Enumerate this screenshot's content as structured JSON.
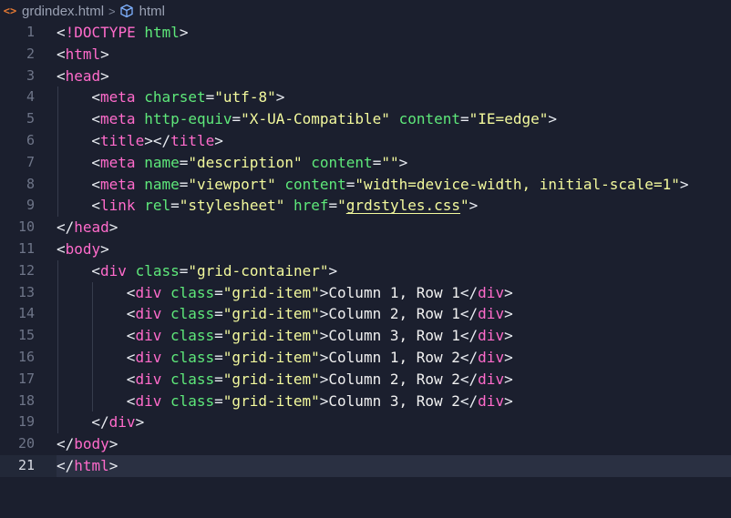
{
  "breadcrumb": {
    "file_icon": "<>",
    "file_name": "grdindex.html",
    "separator": ">",
    "symbol_icon": "cube-icon",
    "element": "html"
  },
  "editor": {
    "current_line": 21,
    "lines": [
      {
        "n": "1",
        "indent": 0,
        "tokens": [
          [
            "punct",
            "<"
          ],
          [
            "tag",
            "!DOCTYPE"
          ],
          [
            "punct",
            " "
          ],
          [
            "attr",
            "html"
          ],
          [
            "punct",
            ">"
          ]
        ]
      },
      {
        "n": "2",
        "indent": 0,
        "tokens": [
          [
            "punct",
            "<"
          ],
          [
            "tag",
            "html"
          ],
          [
            "punct",
            ">"
          ]
        ]
      },
      {
        "n": "3",
        "indent": 0,
        "tokens": [
          [
            "punct",
            "<"
          ],
          [
            "tag",
            "head"
          ],
          [
            "punct",
            ">"
          ]
        ]
      },
      {
        "n": "4",
        "indent": 1,
        "tokens": [
          [
            "punct",
            "<"
          ],
          [
            "tag",
            "meta"
          ],
          [
            "punct",
            " "
          ],
          [
            "attr",
            "charset"
          ],
          [
            "punct",
            "="
          ],
          [
            "str",
            "\"utf-8\""
          ],
          [
            "punct",
            ">"
          ]
        ]
      },
      {
        "n": "5",
        "indent": 1,
        "tokens": [
          [
            "punct",
            "<"
          ],
          [
            "tag",
            "meta"
          ],
          [
            "punct",
            " "
          ],
          [
            "attr",
            "http-equiv"
          ],
          [
            "punct",
            "="
          ],
          [
            "str",
            "\"X-UA-Compatible\""
          ],
          [
            "punct",
            " "
          ],
          [
            "attr",
            "content"
          ],
          [
            "punct",
            "="
          ],
          [
            "str",
            "\"IE=edge\""
          ],
          [
            "punct",
            ">"
          ]
        ]
      },
      {
        "n": "6",
        "indent": 1,
        "tokens": [
          [
            "punct",
            "<"
          ],
          [
            "tag",
            "title"
          ],
          [
            "punct",
            "></"
          ],
          [
            "tag",
            "title"
          ],
          [
            "punct",
            ">"
          ]
        ]
      },
      {
        "n": "7",
        "indent": 1,
        "tokens": [
          [
            "punct",
            "<"
          ],
          [
            "tag",
            "meta"
          ],
          [
            "punct",
            " "
          ],
          [
            "attr",
            "name"
          ],
          [
            "punct",
            "="
          ],
          [
            "str",
            "\"description\""
          ],
          [
            "punct",
            " "
          ],
          [
            "attr",
            "content"
          ],
          [
            "punct",
            "="
          ],
          [
            "str",
            "\"\""
          ],
          [
            "punct",
            ">"
          ]
        ]
      },
      {
        "n": "8",
        "indent": 1,
        "tokens": [
          [
            "punct",
            "<"
          ],
          [
            "tag",
            "meta"
          ],
          [
            "punct",
            " "
          ],
          [
            "attr",
            "name"
          ],
          [
            "punct",
            "="
          ],
          [
            "str",
            "\"viewport\""
          ],
          [
            "punct",
            " "
          ],
          [
            "attr",
            "content"
          ],
          [
            "punct",
            "="
          ],
          [
            "str",
            "\"width=device-width, initial-scale=1\""
          ],
          [
            "punct",
            ">"
          ]
        ]
      },
      {
        "n": "9",
        "indent": 1,
        "tokens": [
          [
            "punct",
            "<"
          ],
          [
            "tag",
            "link"
          ],
          [
            "punct",
            " "
          ],
          [
            "attr",
            "rel"
          ],
          [
            "punct",
            "="
          ],
          [
            "str",
            "\"stylesheet\""
          ],
          [
            "punct",
            " "
          ],
          [
            "attr",
            "href"
          ],
          [
            "punct",
            "="
          ],
          [
            "str",
            "\""
          ],
          [
            "link",
            "grdstyles.css"
          ],
          [
            "str",
            "\""
          ],
          [
            "punct",
            ">"
          ]
        ]
      },
      {
        "n": "10",
        "indent": 0,
        "tokens": [
          [
            "punct",
            "</"
          ],
          [
            "tag",
            "head"
          ],
          [
            "punct",
            ">"
          ]
        ]
      },
      {
        "n": "11",
        "indent": 0,
        "tokens": [
          [
            "punct",
            "<"
          ],
          [
            "tag",
            "body"
          ],
          [
            "punct",
            ">"
          ]
        ]
      },
      {
        "n": "12",
        "indent": 1,
        "tokens": [
          [
            "punct",
            "<"
          ],
          [
            "tag",
            "div"
          ],
          [
            "punct",
            " "
          ],
          [
            "attr",
            "class"
          ],
          [
            "punct",
            "="
          ],
          [
            "str",
            "\"grid-container\""
          ],
          [
            "punct",
            ">"
          ]
        ]
      },
      {
        "n": "13",
        "indent": 2,
        "tokens": [
          [
            "punct",
            "<"
          ],
          [
            "tag",
            "div"
          ],
          [
            "punct",
            " "
          ],
          [
            "attr",
            "class"
          ],
          [
            "punct",
            "="
          ],
          [
            "str",
            "\"grid-item\""
          ],
          [
            "punct",
            ">"
          ],
          [
            "txt",
            "Column 1, Row 1"
          ],
          [
            "punct",
            "</"
          ],
          [
            "tag",
            "div"
          ],
          [
            "punct",
            ">"
          ]
        ]
      },
      {
        "n": "14",
        "indent": 2,
        "tokens": [
          [
            "punct",
            "<"
          ],
          [
            "tag",
            "div"
          ],
          [
            "punct",
            " "
          ],
          [
            "attr",
            "class"
          ],
          [
            "punct",
            "="
          ],
          [
            "str",
            "\"grid-item\""
          ],
          [
            "punct",
            ">"
          ],
          [
            "txt",
            "Column 2, Row 1"
          ],
          [
            "punct",
            "</"
          ],
          [
            "tag",
            "div"
          ],
          [
            "punct",
            ">"
          ]
        ]
      },
      {
        "n": "15",
        "indent": 2,
        "tokens": [
          [
            "punct",
            "<"
          ],
          [
            "tag",
            "div"
          ],
          [
            "punct",
            " "
          ],
          [
            "attr",
            "class"
          ],
          [
            "punct",
            "="
          ],
          [
            "str",
            "\"grid-item\""
          ],
          [
            "punct",
            ">"
          ],
          [
            "txt",
            "Column 3, Row 1"
          ],
          [
            "punct",
            "</"
          ],
          [
            "tag",
            "div"
          ],
          [
            "punct",
            ">"
          ]
        ]
      },
      {
        "n": "16",
        "indent": 2,
        "tokens": [
          [
            "punct",
            "<"
          ],
          [
            "tag",
            "div"
          ],
          [
            "punct",
            " "
          ],
          [
            "attr",
            "class"
          ],
          [
            "punct",
            "="
          ],
          [
            "str",
            "\"grid-item\""
          ],
          [
            "punct",
            ">"
          ],
          [
            "txt",
            "Column 1, Row 2"
          ],
          [
            "punct",
            "</"
          ],
          [
            "tag",
            "div"
          ],
          [
            "punct",
            ">"
          ]
        ]
      },
      {
        "n": "17",
        "indent": 2,
        "tokens": [
          [
            "punct",
            "<"
          ],
          [
            "tag",
            "div"
          ],
          [
            "punct",
            " "
          ],
          [
            "attr",
            "class"
          ],
          [
            "punct",
            "="
          ],
          [
            "str",
            "\"grid-item\""
          ],
          [
            "punct",
            ">"
          ],
          [
            "txt",
            "Column 2, Row 2"
          ],
          [
            "punct",
            "</"
          ],
          [
            "tag",
            "div"
          ],
          [
            "punct",
            ">"
          ]
        ]
      },
      {
        "n": "18",
        "indent": 2,
        "tokens": [
          [
            "punct",
            "<"
          ],
          [
            "tag",
            "div"
          ],
          [
            "punct",
            " "
          ],
          [
            "attr",
            "class"
          ],
          [
            "punct",
            "="
          ],
          [
            "str",
            "\"grid-item\""
          ],
          [
            "punct",
            ">"
          ],
          [
            "txt",
            "Column 3, Row 2"
          ],
          [
            "punct",
            "</"
          ],
          [
            "tag",
            "div"
          ],
          [
            "punct",
            ">"
          ]
        ]
      },
      {
        "n": "19",
        "indent": 1,
        "tokens": [
          [
            "punct",
            "</"
          ],
          [
            "tag",
            "div"
          ],
          [
            "punct",
            ">"
          ]
        ]
      },
      {
        "n": "20",
        "indent": 0,
        "tokens": [
          [
            "punct",
            "</"
          ],
          [
            "tag",
            "body"
          ],
          [
            "punct",
            ">"
          ]
        ]
      },
      {
        "n": "21",
        "indent": 0,
        "tokens": [
          [
            "punct",
            "</"
          ],
          [
            "tag",
            "html"
          ],
          [
            "punct",
            ">"
          ]
        ]
      }
    ]
  },
  "colors": {
    "background": "#1b1f2e",
    "tag": "#ff6bcb",
    "attribute": "#5ee87a",
    "string": "#f3f99d",
    "text": "#f1f1f1"
  }
}
